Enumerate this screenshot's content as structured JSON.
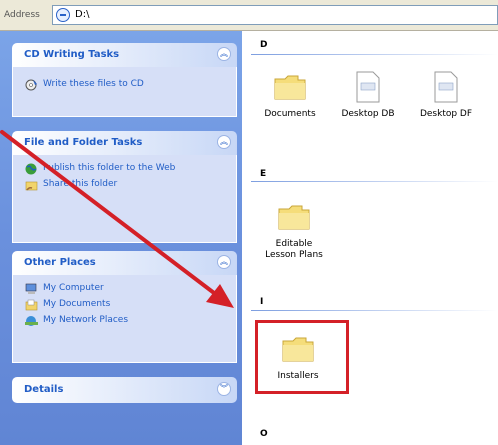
{
  "address": {
    "label": "Address",
    "path": "D:\\"
  },
  "tasks": {
    "cd_writing": {
      "title": "CD Writing Tasks",
      "items": [
        "Write these files to CD"
      ]
    },
    "file_folder": {
      "title": "File and Folder Tasks",
      "items": [
        "Publish this folder to the Web",
        "Share this folder"
      ]
    },
    "other_places": {
      "title": "Other Places",
      "items": [
        "My Computer",
        "My Documents",
        "My Network Places"
      ]
    },
    "details": {
      "title": "Details"
    }
  },
  "content": {
    "sections": [
      "D",
      "E",
      "I",
      "O"
    ],
    "items": {
      "documents": "Documents",
      "desktop_db": "Desktop DB",
      "desktop_df": "Desktop DF",
      "editable": "Editable Lesson Plans",
      "installers": "Installers"
    }
  },
  "colors": {
    "highlight": "#d42027",
    "link": "#215dc6"
  }
}
